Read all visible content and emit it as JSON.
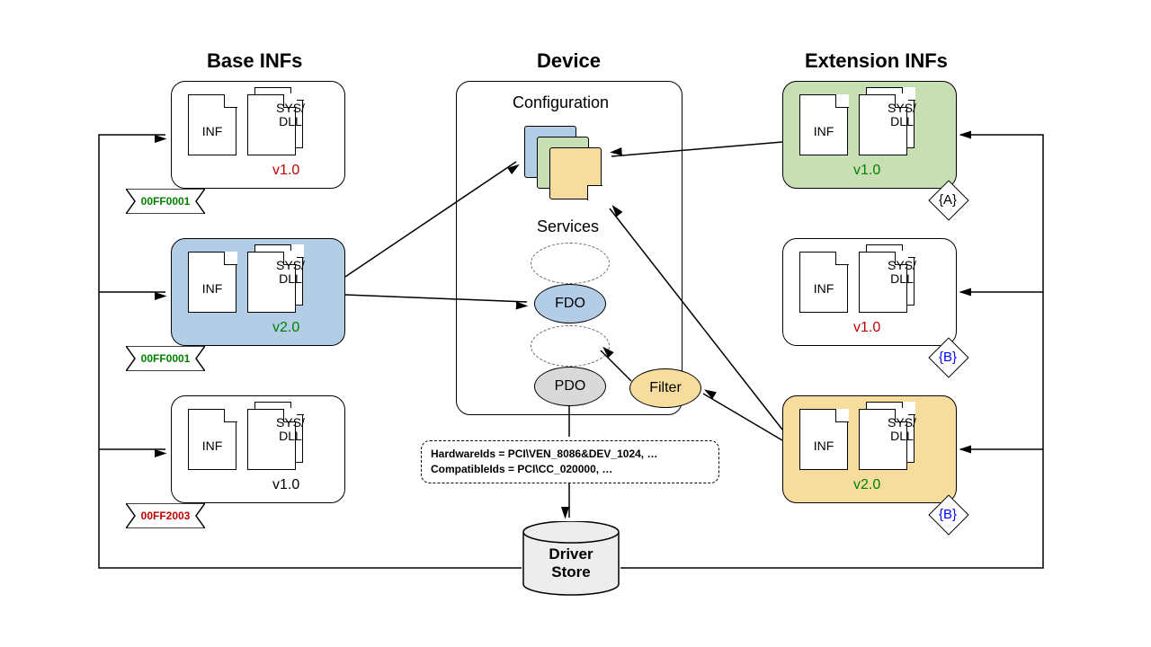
{
  "headings": {
    "base": "Base INFs",
    "device": "Device",
    "ext": "Extension INFs"
  },
  "sub": {
    "config": "Configuration",
    "services": "Services"
  },
  "doc": {
    "inf": "INF",
    "sysdll": "SYS/\nDLL"
  },
  "base_packages": [
    {
      "version": "v1.0",
      "version_color": "red",
      "ribbon": "00FF0001",
      "ribbon_color": "greenT"
    },
    {
      "version": "v2.0",
      "version_color": "greenT",
      "ribbon": "00FF0001",
      "ribbon_color": "greenT"
    },
    {
      "version": "v1.0",
      "version_color": "black",
      "ribbon": "00FF2003",
      "ribbon_color": "red"
    }
  ],
  "ext_packages": [
    {
      "version": "v1.0",
      "version_color": "greenT",
      "tag": "{A}",
      "tag_color": "black"
    },
    {
      "version": "v1.0",
      "version_color": "red",
      "tag": "{B}",
      "tag_color": "blueT"
    },
    {
      "version": "v2.0",
      "version_color": "greenT",
      "tag": "{B}",
      "tag_color": "blueT"
    }
  ],
  "objects": {
    "fdo": "FDO",
    "pdo": "PDO",
    "filter": "Filter"
  },
  "ids": {
    "hw": "HardwareIds = PCI\\VEN_8086&DEV_1024, …",
    "compat": "CompatibleIds = PCI\\CC_020000, …"
  },
  "store": {
    "l1": "Driver",
    "l2": "Store"
  }
}
